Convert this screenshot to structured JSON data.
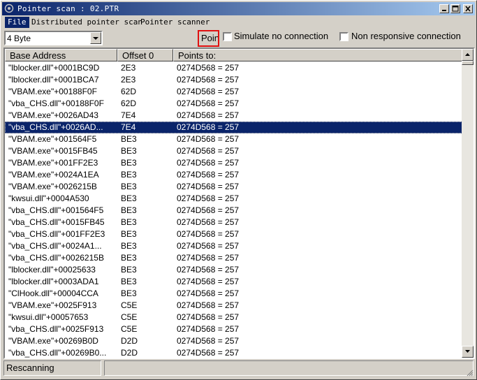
{
  "window": {
    "title": "Pointer scan : 02.PTR"
  },
  "menu": {
    "items": [
      "File",
      "Distributed pointer scan",
      "Pointer scanner"
    ],
    "active_index": 0
  },
  "toolbar": {
    "value_type": "4 Byte",
    "highlighted_label": "Poin",
    "simulate_no_connection": {
      "label": "Simulate no connection",
      "checked": false
    },
    "non_responsive_connection": {
      "label": "Non responsive connection",
      "checked": false
    }
  },
  "table": {
    "columns": [
      "Base Address",
      "Offset 0",
      "Points to:"
    ],
    "selected_row": 5,
    "rows": [
      [
        "\"lblocker.dll\"+0001BC9D",
        "2E3",
        "0274D568 = 257"
      ],
      [
        "\"lblocker.dll\"+0001BCA7",
        "2E3",
        "0274D568 = 257"
      ],
      [
        "\"VBAM.exe\"+00188F0F",
        "62D",
        "0274D568 = 257"
      ],
      [
        "\"vba_CHS.dll\"+00188F0F",
        "62D",
        "0274D568 = 257"
      ],
      [
        "\"VBAM.exe\"+0026AD43",
        "7E4",
        "0274D568 = 257"
      ],
      [
        "\"vba_CHS.dll\"+0026AD...",
        "7E4",
        "0274D568 = 257"
      ],
      [
        "\"VBAM.exe\"+001564F5",
        "BE3",
        "0274D568 = 257"
      ],
      [
        "\"VBAM.exe\"+0015FB45",
        "BE3",
        "0274D568 = 257"
      ],
      [
        "\"VBAM.exe\"+001FF2E3",
        "BE3",
        "0274D568 = 257"
      ],
      [
        "\"VBAM.exe\"+0024A1EA",
        "BE3",
        "0274D568 = 257"
      ],
      [
        "\"VBAM.exe\"+0026215B",
        "BE3",
        "0274D568 = 257"
      ],
      [
        "\"kwsui.dll\"+0004A530",
        "BE3",
        "0274D568 = 257"
      ],
      [
        "\"vba_CHS.dll\"+001564F5",
        "BE3",
        "0274D568 = 257"
      ],
      [
        "\"vba_CHS.dll\"+0015FB45",
        "BE3",
        "0274D568 = 257"
      ],
      [
        "\"vba_CHS.dll\"+001FF2E3",
        "BE3",
        "0274D568 = 257"
      ],
      [
        "\"vba_CHS.dll\"+0024A1...",
        "BE3",
        "0274D568 = 257"
      ],
      [
        "\"vba_CHS.dll\"+0026215B",
        "BE3",
        "0274D568 = 257"
      ],
      [
        "\"lblocker.dll\"+00025633",
        "BE3",
        "0274D568 = 257"
      ],
      [
        "\"lblocker.dll\"+0003ADA1",
        "BE3",
        "0274D568 = 257"
      ],
      [
        "\"ClHook.dll\"+00004CCA",
        "BE3",
        "0274D568 = 257"
      ],
      [
        "\"VBAM.exe\"+0025F913",
        "C5E",
        "0274D568 = 257"
      ],
      [
        "\"kwsui.dll\"+00057653",
        "C5E",
        "0274D568 = 257"
      ],
      [
        "\"vba_CHS.dll\"+0025F913",
        "C5E",
        "0274D568 = 257"
      ],
      [
        "\"VBAM.exe\"+00269B0D",
        "D2D",
        "0274D568 = 257"
      ],
      [
        "\"vba_CHS.dll\"+00269B0...",
        "D2D",
        "0274D568 = 257"
      ]
    ]
  },
  "status": {
    "text": "Rescanning",
    "progress": 0
  },
  "colors": {
    "title_start": "#0a246a",
    "title_end": "#a6caf0",
    "selection": "#0a246a",
    "highlight_border": "#e01010",
    "face": "#d4d0c8"
  },
  "icons": [
    "app-icon",
    "minimize-icon",
    "maximize-icon",
    "close-icon",
    "dropdown-arrow-icon",
    "scroll-up-arrow-icon",
    "scroll-down-arrow-icon",
    "size-grip-icon"
  ]
}
